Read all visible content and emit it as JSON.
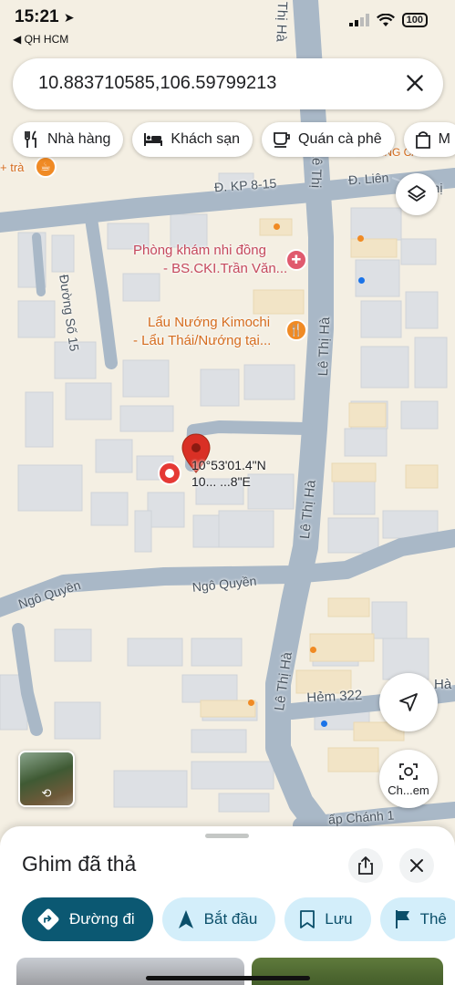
{
  "status_bar": {
    "time": "15:21",
    "back_label": "◀ QH HCM",
    "battery": "100"
  },
  "search": {
    "query": "10.883710585,106.59799213"
  },
  "chips": [
    {
      "label": "Nhà hàng",
      "icon": "fork-knife-icon"
    },
    {
      "label": "Khách sạn",
      "icon": "bed-icon"
    },
    {
      "label": "Quán cà phê",
      "icon": "coffee-cup-icon"
    },
    {
      "label": "M",
      "icon": "shopping-bag-icon"
    }
  ],
  "map": {
    "roads": {
      "kp_8_15": "Đ. KP 8-15",
      "lien": "Đ. Liên",
      "thi": "Thị",
      "duong_so_15": "Đường Số 15",
      "le_thi_ha_1": "Lê Thị Hà",
      "le_thi_ha_2": "Lê Thị Hà",
      "le_thi_ha_3": "Lê Thị Hà",
      "le_thi_ha_top": "Thị Hà",
      "le_thi_ha_vertical_top": "Lê Thị",
      "ngo_quyen_1": "Ngô Quyền",
      "ngo_quyen_2": "Ngô Quyền",
      "hem_322": "Hẻm 322",
      "ha": "Hà",
      "chanh": "ấp Chánh 1",
      "top_partial": "MIỀN MÁNG CÁ G",
      "tra": "+ trà"
    },
    "pois": {
      "clinic_line1": "Phòng khám nhi đồng",
      "clinic_line2": "- BS.CKI.Trần Văn...",
      "restaurant_line1": "Lẩu Nướng Kimochi",
      "restaurant_line2": "- Lẩu Thái/Nướng tại..."
    },
    "pin_coords": {
      "lat": "10°53'01.4\"N",
      "lng": "10... ...8\"E"
    },
    "colors": {
      "road": "#a9b8c7",
      "background": "#f4efe3",
      "building": "#dde0e4",
      "pin": "#d93025"
    }
  },
  "fabs": {
    "layers_icon": "layers-icon",
    "locate_icon": "navigation-arrow-icon",
    "check_label": "Ch...em"
  },
  "sheet": {
    "title": "Ghim đã thả",
    "actions": [
      {
        "label": "Đường đi",
        "icon": "directions-icon"
      },
      {
        "label": "Bắt đầu",
        "icon": "navigation-icon"
      },
      {
        "label": "Lưu",
        "icon": "bookmark-icon"
      },
      {
        "label": "Thê",
        "icon": "flag-icon"
      }
    ]
  }
}
